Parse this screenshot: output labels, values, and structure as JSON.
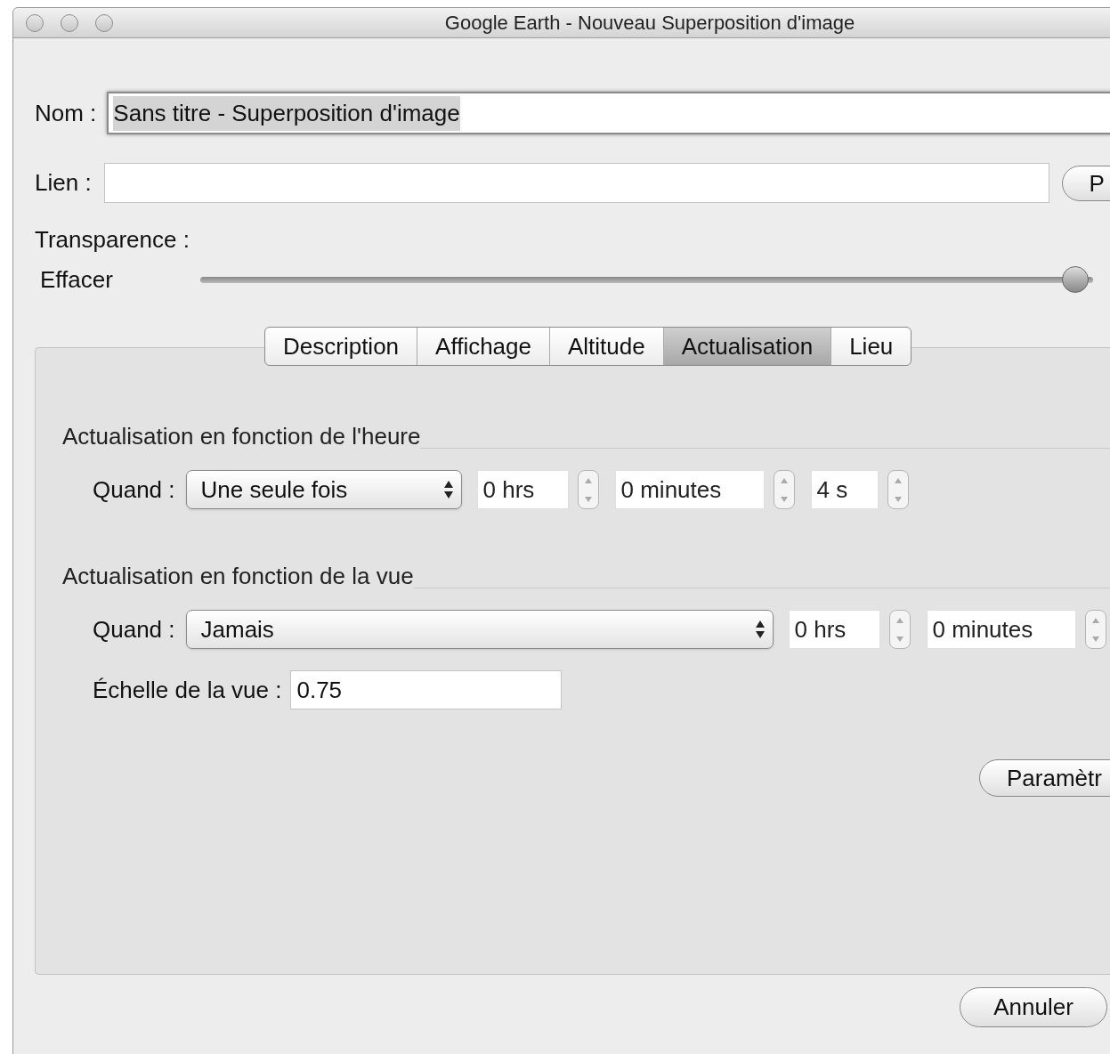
{
  "window": {
    "title": "Google Earth - Nouveau Superposition d'image"
  },
  "name": {
    "label": "Nom :",
    "value": "Sans titre - Superposition d'image",
    "text_selected": true
  },
  "link": {
    "label": "Lien :",
    "button": "P"
  },
  "transparency": {
    "label": "Transparence :",
    "left_label": "Effacer",
    "level": 0.98
  },
  "tabs": [
    {
      "label": "Description",
      "selected": false
    },
    {
      "label": "Affichage",
      "selected": false
    },
    {
      "label": "Altitude",
      "selected": false
    },
    {
      "label": "Actualisation",
      "selected": true
    },
    {
      "label": "Lieu",
      "selected": false
    }
  ],
  "time_refresh": {
    "title": "Actualisation en fonction de l'heure",
    "when_label": "Quand :",
    "when": "Une seule fois",
    "fields": [
      "0 hrs",
      "0 minutes",
      "4 s"
    ]
  },
  "view_refresh": {
    "title": "Actualisation en fonction de la vue",
    "when_label": "Quand :",
    "when": "Jamais",
    "fields": [
      "0 hrs",
      "0 minutes"
    ],
    "scale_label": "Échelle de la vue :",
    "scale": "0.75"
  },
  "parameters_button": "Paramètr",
  "cancel_button": "Annuler"
}
